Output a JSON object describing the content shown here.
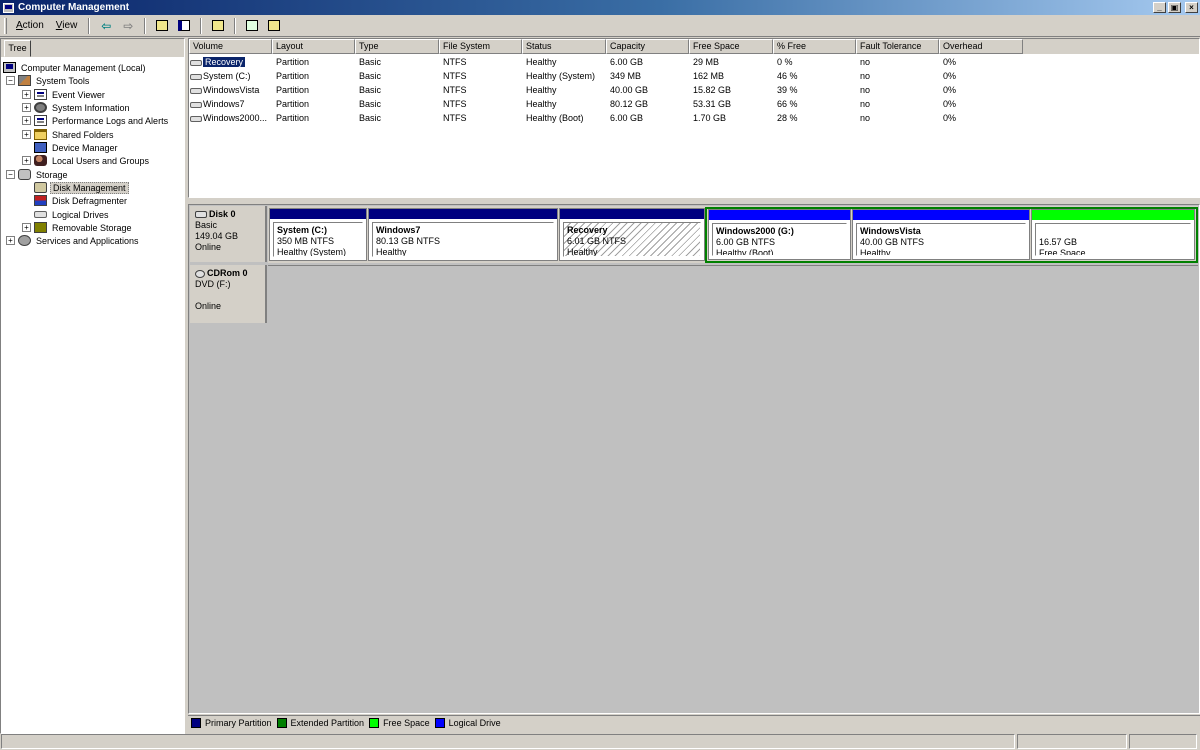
{
  "window": {
    "title": "Computer Management",
    "controls": {
      "minimize": "_",
      "maximize": "▣",
      "close": "×"
    }
  },
  "menu": {
    "action": {
      "underlined": "A",
      "rest": "ction"
    },
    "view": {
      "underlined": "V",
      "rest": "iew"
    }
  },
  "toolbar": {
    "buttons": [
      "back-icon",
      "forward-icon",
      "up-folder-icon",
      "show-hide-tree-icon",
      "properties-icon",
      "refresh-icon",
      "export-icon"
    ]
  },
  "tree": {
    "tab_label": "Tree",
    "items": [
      {
        "label": "Computer Management (Local)",
        "icon": "computer-icon",
        "expander": ""
      },
      {
        "label": "System Tools",
        "icon": "tools-icon",
        "expander": "−"
      },
      {
        "label": "Event Viewer",
        "icon": "event-viewer-icon",
        "expander": "+"
      },
      {
        "label": "System Information",
        "icon": "gear-icon",
        "expander": "+"
      },
      {
        "label": "Performance Logs and Alerts",
        "icon": "performance-icon",
        "expander": "+"
      },
      {
        "label": "Shared Folders",
        "icon": "folder-icon",
        "expander": "+"
      },
      {
        "label": "Device Manager",
        "icon": "device-manager-icon",
        "expander": ""
      },
      {
        "label": "Local Users and Groups",
        "icon": "users-icon",
        "expander": "+"
      },
      {
        "label": "Storage",
        "icon": "storage-icon",
        "expander": "−"
      },
      {
        "label": "Disk Management",
        "icon": "disk-management-icon",
        "expander": ""
      },
      {
        "label": "Disk Defragmenter",
        "icon": "defrag-icon",
        "expander": ""
      },
      {
        "label": "Logical Drives",
        "icon": "drive-icon",
        "expander": ""
      },
      {
        "label": "Removable Storage",
        "icon": "removable-storage-icon",
        "expander": "+"
      },
      {
        "label": "Services and Applications",
        "icon": "services-icon",
        "expander": "+"
      }
    ],
    "selected": "Disk Management"
  },
  "volume_list": {
    "columns": [
      "Volume",
      "Layout",
      "Type",
      "File System",
      "Status",
      "Capacity",
      "Free Space",
      "% Free",
      "Fault Tolerance",
      "Overhead"
    ],
    "rows": [
      [
        "Recovery",
        "Partition",
        "Basic",
        "NTFS",
        "Healthy",
        "6.00 GB",
        "29 MB",
        "0 %",
        "no",
        "0%"
      ],
      [
        "System (C:)",
        "Partition",
        "Basic",
        "NTFS",
        "Healthy (System)",
        "349 MB",
        "162 MB",
        "46 %",
        "no",
        "0%"
      ],
      [
        "WindowsVista",
        "Partition",
        "Basic",
        "NTFS",
        "Healthy",
        "40.00 GB",
        "15.82 GB",
        "39 %",
        "no",
        "0%"
      ],
      [
        "Windows7",
        "Partition",
        "Basic",
        "NTFS",
        "Healthy",
        "80.12 GB",
        "53.31 GB",
        "66 %",
        "no",
        "0%"
      ],
      [
        "Windows2000...",
        "Partition",
        "Basic",
        "NTFS",
        "Healthy (Boot)",
        "6.00 GB",
        "1.70 GB",
        "28 %",
        "no",
        "0%"
      ]
    ],
    "selected_row": 0
  },
  "disks": [
    {
      "name": "Disk 0",
      "type": "Basic",
      "size": "149.04 GB",
      "status": "Online",
      "partitions": [
        {
          "name": "System  (C:)",
          "size": "350 MB NTFS",
          "status": "Healthy (System)",
          "kind": "primary"
        },
        {
          "name": "Windows7",
          "size": "80.13 GB NTFS",
          "status": "Healthy",
          "kind": "primary"
        },
        {
          "name": "Recovery",
          "size": "6.01 GB NTFS",
          "status": "Healthy",
          "kind": "primary",
          "selected": true
        },
        {
          "name": "Windows2000  (G:)",
          "size": "6.00 GB NTFS",
          "status": "Healthy (Boot)",
          "kind": "logical"
        },
        {
          "name": "WindowsVista",
          "size": "40.00 GB NTFS",
          "status": "Healthy",
          "kind": "logical"
        },
        {
          "name": "",
          "size": "16.57 GB",
          "status": "Free Space",
          "kind": "free"
        }
      ]
    },
    {
      "name": "CDRom 0",
      "type": "DVD (F:)",
      "size": "",
      "status": "Online"
    }
  ],
  "legend": [
    {
      "label": "Primary Partition",
      "color": "#000080"
    },
    {
      "label": "Extended Partition",
      "color": "#008000"
    },
    {
      "label": "Free Space",
      "color": "#00ff00"
    },
    {
      "label": "Logical Drive",
      "color": "#0000ff"
    }
  ],
  "colors": {
    "primary": "#000080",
    "extended": "#008000",
    "free": "#00ff00",
    "logical": "#0000ff",
    "selection": "#0a246a"
  }
}
